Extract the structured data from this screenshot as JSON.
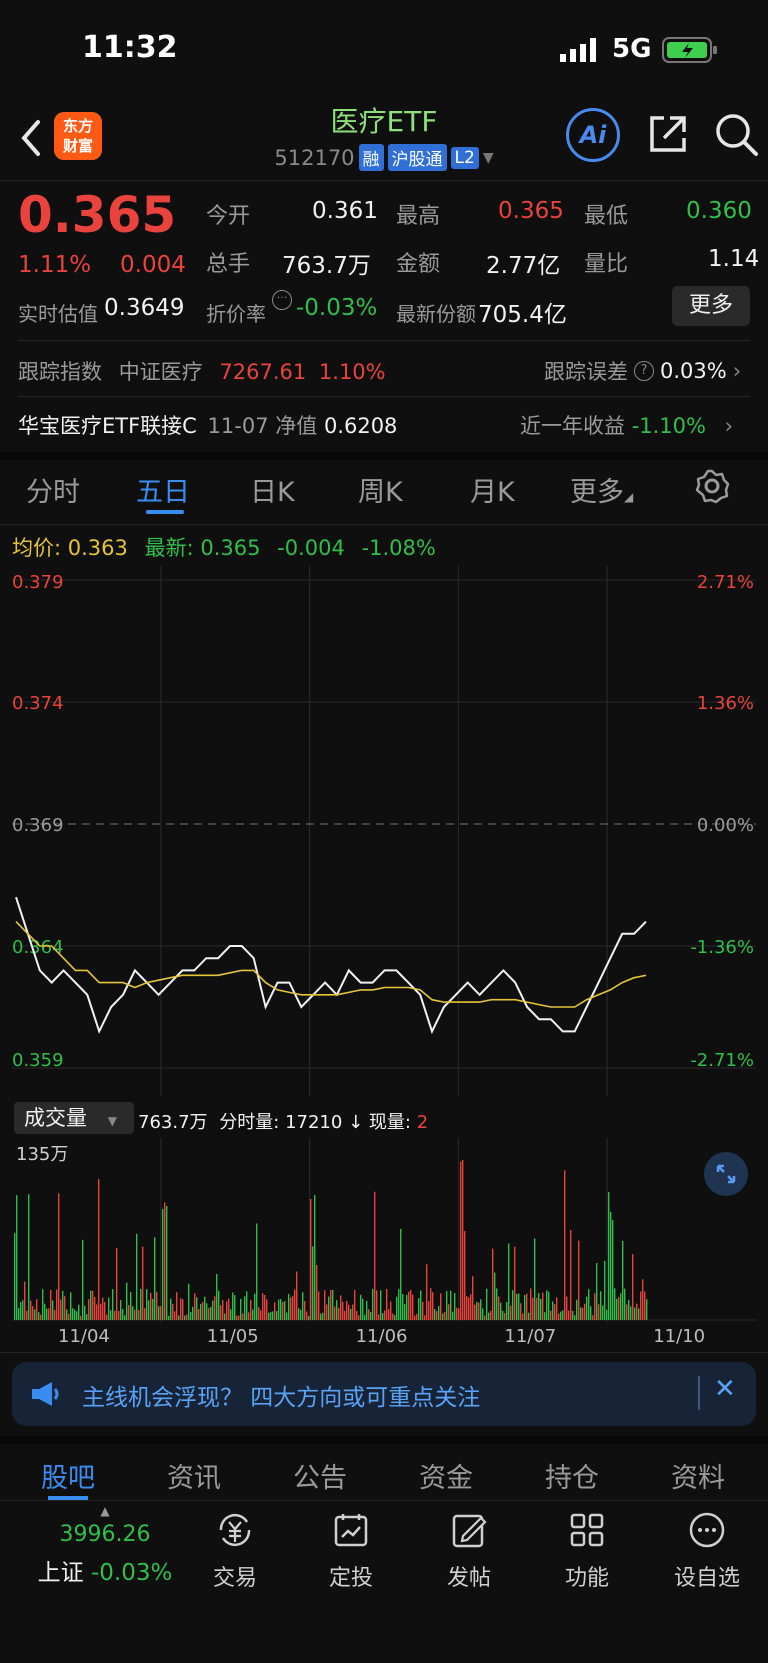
{
  "status": {
    "time": "11:32",
    "network": "5G"
  },
  "header": {
    "logo_line1": "东方",
    "logo_line2": "财富",
    "fund_name": "医疗ETF",
    "code": "512170",
    "tags": [
      "融",
      "沪股通",
      "L2"
    ]
  },
  "quote": {
    "price": "0.365",
    "change_pct": "1.11%",
    "change_amt": "0.004",
    "open_label": "今开",
    "open": "0.361",
    "high_label": "最高",
    "high": "0.365",
    "low_label": "最低",
    "low": "0.360",
    "volume_label": "总手",
    "volume": "763.7万",
    "amount_label": "金额",
    "amount": "2.77亿",
    "vol_ratio_label": "量比",
    "vol_ratio": "1.14",
    "iopv_label": "实时估值",
    "iopv": "0.3649",
    "discount_label": "折价率",
    "discount": "-0.03%",
    "shares_label": "最新份额",
    "shares": "705.4亿",
    "more_label": "更多"
  },
  "tracking": {
    "index_label": "跟踪指数",
    "index_name": "中证医疗",
    "index_value": "7267.61",
    "index_pct": "1.10%",
    "error_label": "跟踪误差",
    "error_value": "0.03%"
  },
  "linked_fund": {
    "name": "华宝医疗ETF联接C",
    "date": "11-07",
    "nav_label": "净值",
    "nav": "0.6208",
    "return_label": "近一年收益",
    "return_value": "-1.10%"
  },
  "chart_tabs": [
    "分时",
    "五日",
    "日K",
    "周K",
    "月K",
    "更多"
  ],
  "chart_info": {
    "avg_label": "均价:",
    "avg": "0.363",
    "latest_label": "最新:",
    "latest": "0.365",
    "change": "-0.004",
    "change_pct": "-1.08%"
  },
  "chart_data": {
    "type": "line",
    "y_left_ticks": [
      "0.379",
      "0.374",
      "0.369",
      "0.364",
      "0.359"
    ],
    "y_right_ticks": [
      "2.71%",
      "1.36%",
      "0.00%",
      "-1.36%",
      "-2.71%"
    ],
    "ylim": [
      0.359,
      0.379
    ],
    "reference_price": 0.369,
    "x_labels": [
      "11/04",
      "11/05",
      "11/06",
      "11/07",
      "11/10"
    ],
    "price_series": [
      0.366,
      0.3645,
      0.363,
      0.3625,
      0.363,
      0.3625,
      0.362,
      0.3605,
      0.3615,
      0.362,
      0.363,
      0.3625,
      0.362,
      0.3625,
      0.363,
      0.363,
      0.3635,
      0.3635,
      0.364,
      0.364,
      0.3635,
      0.3615,
      0.3625,
      0.3625,
      0.3615,
      0.362,
      0.3625,
      0.362,
      0.363,
      0.3625,
      0.3625,
      0.363,
      0.363,
      0.3625,
      0.362,
      0.3605,
      0.3615,
      0.362,
      0.3625,
      0.362,
      0.3625,
      0.363,
      0.3625,
      0.3615,
      0.361,
      0.361,
      0.3605,
      0.3605,
      0.3615,
      0.3625,
      0.3635,
      0.3645,
      0.3645,
      0.365
    ],
    "avg_series": [
      0.365,
      0.3645,
      0.364,
      0.364,
      0.3635,
      0.363,
      0.363,
      0.3625,
      0.3625,
      0.3625,
      0.3623,
      0.3625,
      0.3626,
      0.3627,
      0.3628,
      0.3628,
      0.3628,
      0.3628,
      0.3629,
      0.363,
      0.363,
      0.3625,
      0.3622,
      0.3621,
      0.362,
      0.362,
      0.362,
      0.362,
      0.3621,
      0.3622,
      0.3622,
      0.3623,
      0.3623,
      0.3623,
      0.3622,
      0.3618,
      0.3617,
      0.3617,
      0.3617,
      0.3617,
      0.3618,
      0.3618,
      0.3618,
      0.3617,
      0.3616,
      0.3615,
      0.3615,
      0.3615,
      0.3618,
      0.362,
      0.3622,
      0.3625,
      0.3627,
      0.3628
    ],
    "volume_label": "成交量",
    "volume_total": "763.7万",
    "minute_vol_label": "分时量:",
    "minute_vol": "17210",
    "current_vol_label": "现量:",
    "current_vol": "2",
    "volume_max_label": "135万"
  },
  "banner": {
    "text": "主线机会浮现？ 四大方向或可重点关注"
  },
  "bottom_tabs": [
    "股吧",
    "资讯",
    "公告",
    "资金",
    "持仓",
    "资料"
  ],
  "index_quote": {
    "value": "3996.26",
    "name": "上证",
    "pct": "-0.03%"
  },
  "toolbar": [
    "交易",
    "定投",
    "发帖",
    "功能",
    "设自选"
  ],
  "colors": {
    "up": "#e8433c",
    "down": "#2fbf4a",
    "accent": "#3a8df0",
    "brand": "#ff5a14"
  }
}
